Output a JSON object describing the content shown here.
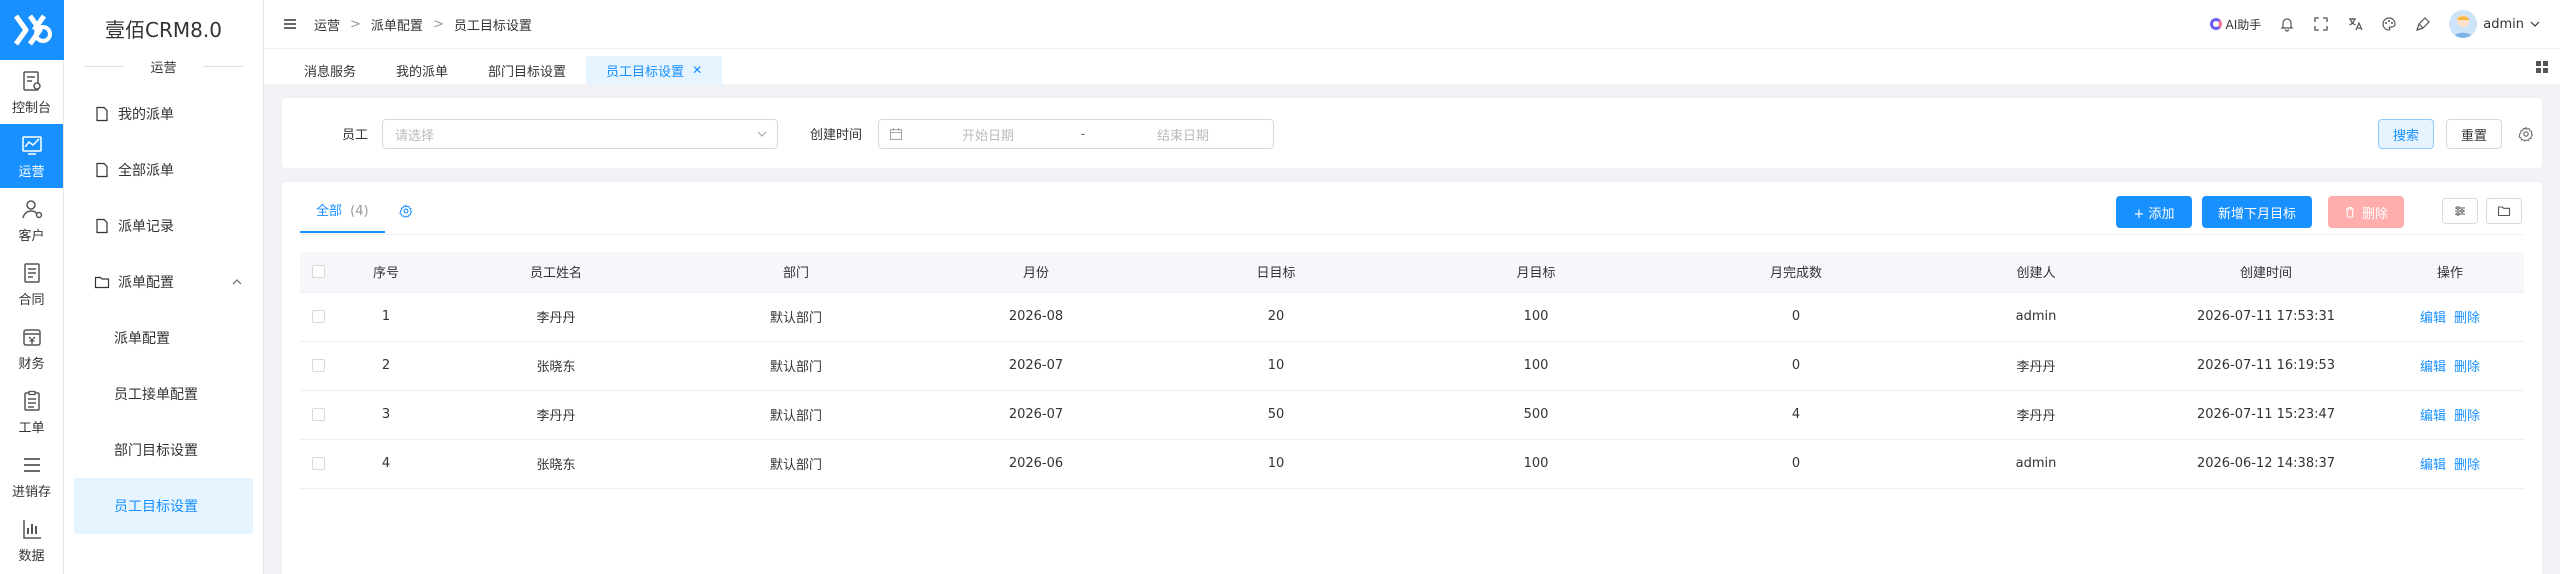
{
  "app": {
    "name": "壹佰CRM8.0",
    "section": "运营"
  },
  "rail": [
    {
      "label": "控制台",
      "icon": "dashboard-icon"
    },
    {
      "label": "运营",
      "icon": "chart-line-icon",
      "active": true
    },
    {
      "label": "客户",
      "icon": "user-icon"
    },
    {
      "label": "合同",
      "icon": "contract-icon"
    },
    {
      "label": "财务",
      "icon": "finance-icon"
    },
    {
      "label": "工单",
      "icon": "clipboard-icon"
    },
    {
      "label": "进销存",
      "icon": "list-icon"
    },
    {
      "label": "数据",
      "icon": "bar-chart-icon"
    }
  ],
  "submenu": {
    "items": [
      {
        "label": "我的派单"
      },
      {
        "label": "全部派单"
      },
      {
        "label": "派单记录"
      }
    ],
    "group": {
      "label": "派单配置",
      "children": [
        {
          "label": "派单配置"
        },
        {
          "label": "员工接单配置"
        },
        {
          "label": "部门目标设置"
        },
        {
          "label": "员工目标设置",
          "active": true
        }
      ]
    }
  },
  "header": {
    "breadcrumb": [
      "运营",
      "派单配置",
      "员工目标设置"
    ],
    "ai_label": "AI助手",
    "user": "admin"
  },
  "tabs": [
    {
      "label": "消息服务"
    },
    {
      "label": "我的派单"
    },
    {
      "label": "部门目标设置"
    },
    {
      "label": "员工目标设置",
      "active": true
    }
  ],
  "filter": {
    "employee_label": "员工",
    "employee_placeholder": "请选择",
    "created_label": "创建时间",
    "start_placeholder": "开始日期",
    "dash": "-",
    "end_placeholder": "结束日期",
    "search_label": "搜索",
    "reset_label": "重置"
  },
  "main": {
    "tab_label": "全部",
    "tab_count": "(4)",
    "add_label": "+ 添加",
    "next_month_label": "新增下月目标",
    "delete_label": "删除"
  },
  "table": {
    "headers": [
      "序号",
      "员工姓名",
      "部门",
      "月份",
      "日目标",
      "月目标",
      "月完成数",
      "创建人",
      "创建时间",
      "操作"
    ],
    "rows": [
      {
        "no": "1",
        "name": "李丹丹",
        "dept": "默认部门",
        "month": "2026-08",
        "daily": "20",
        "monthly": "100",
        "done": "0",
        "creator": "admin",
        "created": "2026-07-11 17:53:31"
      },
      {
        "no": "2",
        "name": "张晓东",
        "dept": "默认部门",
        "month": "2026-07",
        "daily": "10",
        "monthly": "100",
        "done": "0",
        "creator": "李丹丹",
        "created": "2026-07-11 16:19:53"
      },
      {
        "no": "3",
        "name": "李丹丹",
        "dept": "默认部门",
        "month": "2026-07",
        "daily": "50",
        "monthly": "500",
        "done": "4",
        "creator": "李丹丹",
        "created": "2026-07-11 15:23:47"
      },
      {
        "no": "4",
        "name": "张晓东",
        "dept": "默认部门",
        "month": "2026-06",
        "daily": "10",
        "monthly": "100",
        "done": "0",
        "creator": "admin",
        "created": "2026-06-12 14:38:37"
      }
    ],
    "edit_label": "编辑",
    "delete_label": "删除"
  },
  "colors": {
    "primary": "#1890ff",
    "primary_light": "#e6f4ff",
    "danger_light": "#ffadad"
  }
}
